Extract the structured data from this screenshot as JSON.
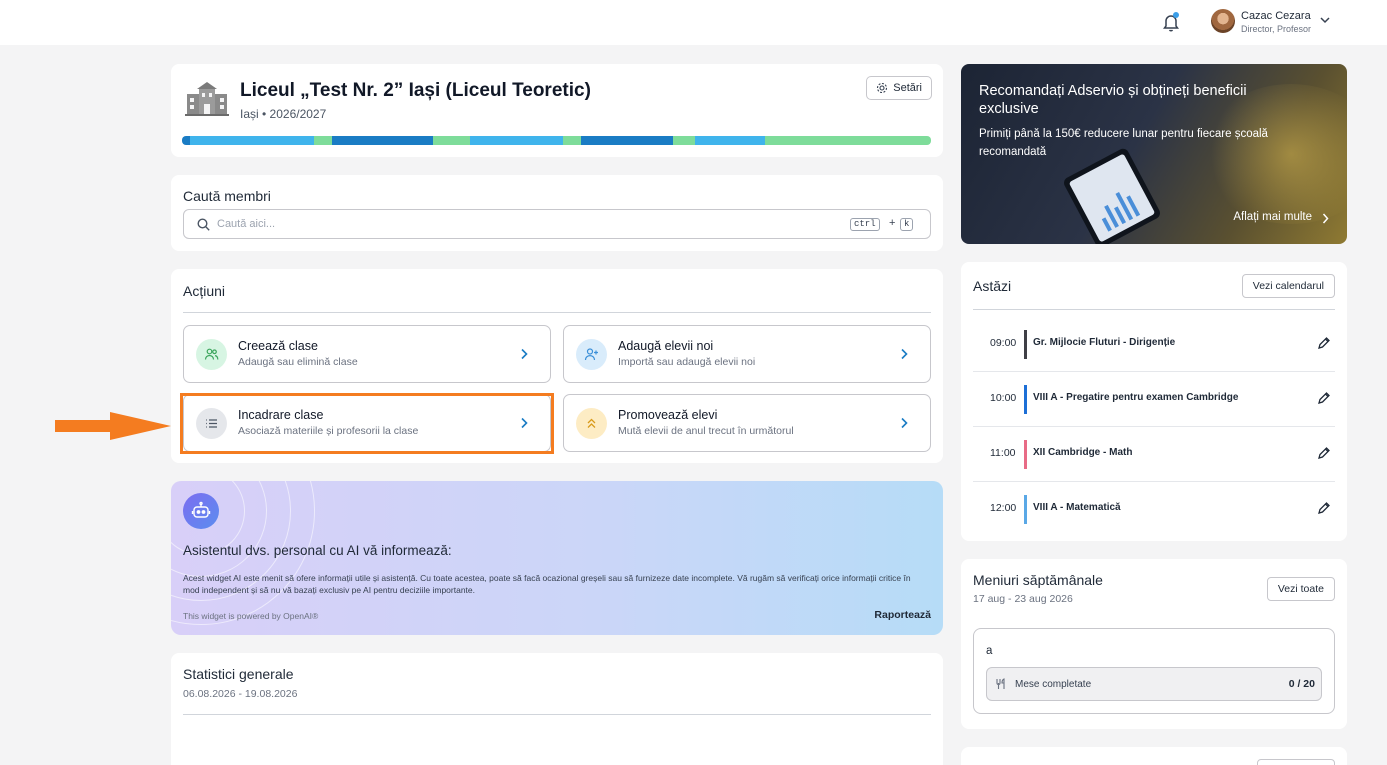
{
  "user": {
    "name": "Cazac Cezara",
    "role": "Director, Profesor"
  },
  "school": {
    "title": "Liceul „Test Nr. 2” Iași (Liceul Teoretic)",
    "subtitle": "Iași • 2026/2027",
    "settings_label": "Setări"
  },
  "search": {
    "title": "Caută membri",
    "placeholder": "Caută aici...",
    "kbd_ctrl": "ctrl",
    "kbd_plus": "+",
    "kbd_k": "k"
  },
  "actions": {
    "title": "Acțiuni",
    "items": [
      {
        "title": "Creează clase",
        "subtitle": "Adaugă sau elimină clase",
        "icon": "users-icon",
        "icon_bg": "#d7f5e3",
        "icon_color": "#3ba55c"
      },
      {
        "title": "Adaugă elevii noi",
        "subtitle": "Importă sau adaugă elevii noi",
        "icon": "user-plus-icon",
        "icon_bg": "#d9ecfb",
        "icon_color": "#3b8fd8"
      },
      {
        "title": "Incadrare clase",
        "subtitle": "Asociază materiile și profesorii la clase",
        "icon": "list-icon",
        "icon_bg": "#e5e7eb",
        "icon_color": "#4b5563"
      },
      {
        "title": "Promovează elevi",
        "subtitle": "Mută elevii de anul trecut în următorul",
        "icon": "chevrons-up-icon",
        "icon_bg": "#fdecc4",
        "icon_color": "#d89a1a"
      }
    ]
  },
  "ai": {
    "title": "Asistentul dvs. personal cu AI vă informează:",
    "disclaimer": "Acest widget AI este menit să ofere informații utile și asistență. Cu toate acestea, poate să facă ocazional greșeli sau să furnizeze date incomplete. Vă rugăm să verificați orice informații critice în mod independent și să nu vă bazați exclusiv pe AI pentru deciziile importante.",
    "powered": "This widget is powered by OpenAI®",
    "report": "Raportează"
  },
  "stats": {
    "title": "Statistici generale",
    "range": "06.08.2026 - 19.08.2026"
  },
  "promo": {
    "title": "Recomandați Adservio și obțineți beneficii exclusive",
    "subtitle": "Primiți până la 150€ reducere lunar pentru fiecare școală recomandată",
    "cta": "Aflați mai multe"
  },
  "today": {
    "title": "Astăzi",
    "calendar_btn": "Vezi calendarul",
    "events": [
      {
        "time": "09:00",
        "name": "Gr. Mijlocie Fluturi - Dirigenție",
        "color": "#3f3f46"
      },
      {
        "time": "10:00",
        "name": "VIII A - Pregatire pentru examen Cambridge",
        "color": "#1d6fd6"
      },
      {
        "time": "11:00",
        "name": "XII Cambridge - Math",
        "color": "#e86b86"
      },
      {
        "time": "12:00",
        "name": "VIII A - Matematică",
        "color": "#5aa8e6"
      }
    ]
  },
  "menus": {
    "title": "Meniuri săptămânale",
    "range": "17 aug - 23 aug 2026",
    "all_btn": "Vezi toate",
    "menu_name": "a",
    "meals_label": "Mese completate",
    "meals_count": "0 / 20"
  },
  "colors": {
    "highlight": "#f47c20",
    "accent": "#1a7cc4"
  }
}
